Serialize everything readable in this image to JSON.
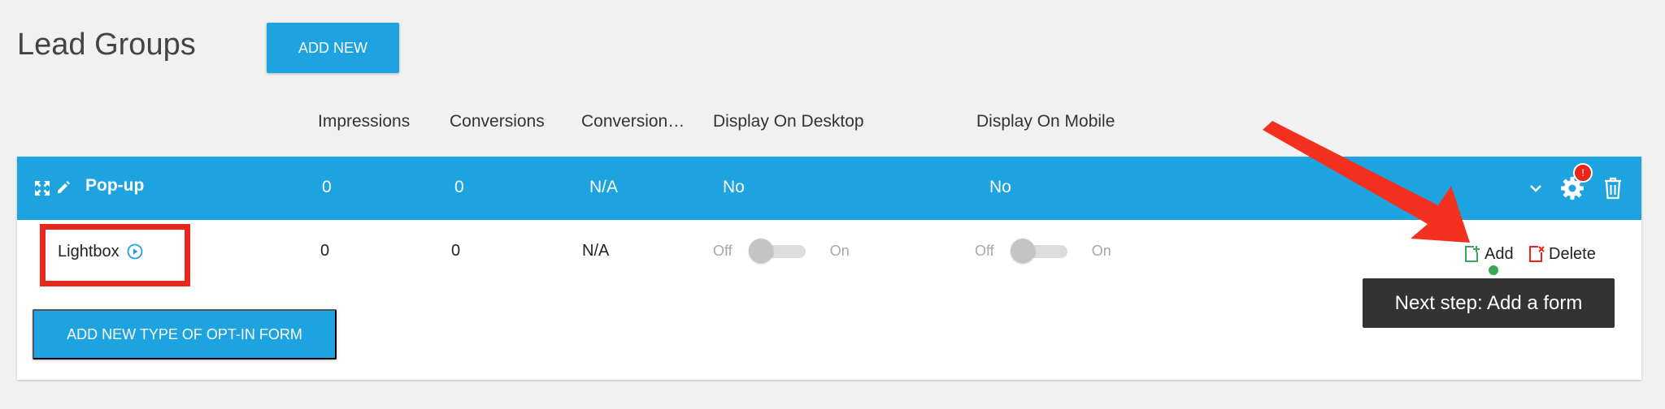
{
  "header": {
    "title": "Lead Groups",
    "add_new_label": "ADD NEW"
  },
  "columns": [
    "Impressions",
    "Conversions",
    "Conversion…",
    "Display On Desktop",
    "Display On Mobile"
  ],
  "group": {
    "name": "Pop-up",
    "impressions": "0",
    "conversions": "0",
    "conversion_rate": "N/A",
    "display_desktop": "No",
    "display_mobile": "No",
    "badge": "!"
  },
  "form_row": {
    "name": "Lightbox",
    "impressions": "0",
    "conversions": "0",
    "conversion_rate": "N/A",
    "desktop_toggle": {
      "off_label": "Off",
      "on_label": "On",
      "state": "off"
    },
    "mobile_toggle": {
      "off_label": "Off",
      "on_label": "On",
      "state": "off"
    },
    "add_label": "Add",
    "delete_label": "Delete"
  },
  "add_type_label": "ADD NEW TYPE OF OPT-IN FORM",
  "tooltip": {
    "text": "Next step: Add a form"
  },
  "icons": {
    "expand": "expand-arrows-icon",
    "edit": "pencil-icon",
    "chevron": "chevron-down-icon",
    "settings": "gear-icon",
    "delete": "trash-icon",
    "play": "play-circle-icon",
    "add": "add-doc-icon",
    "remove": "delete-doc-icon"
  },
  "colors": {
    "accent": "#1ea3e1",
    "highlight": "#e8261a",
    "add_green": "#3aa757",
    "tooltip_bg": "#333333"
  }
}
